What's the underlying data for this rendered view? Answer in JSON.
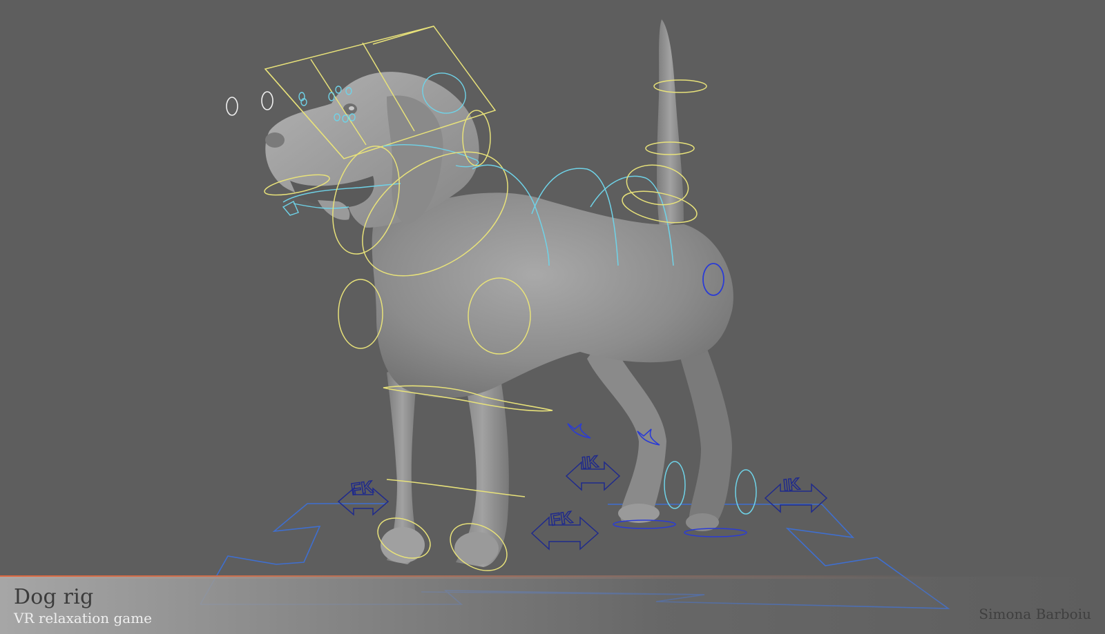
{
  "caption": {
    "title": "Dog rig",
    "subtitle": "VR relaxation game",
    "author": "Simona Barboiu"
  },
  "control_labels": {
    "fk_left": "FK",
    "fk_mid": "FK",
    "ik_mid": "IK",
    "ik_right": "IK"
  },
  "colors": {
    "background": "#5e5e5e",
    "ctrl_yellow": "#e8e27a",
    "ctrl_cyan": "#6fd3e8",
    "ctrl_blue": "#2a3bd6",
    "ctrl_navy": "#1f2a8c",
    "ground_blue": "#3f6fd0",
    "accent_orange": "#e0683f"
  }
}
